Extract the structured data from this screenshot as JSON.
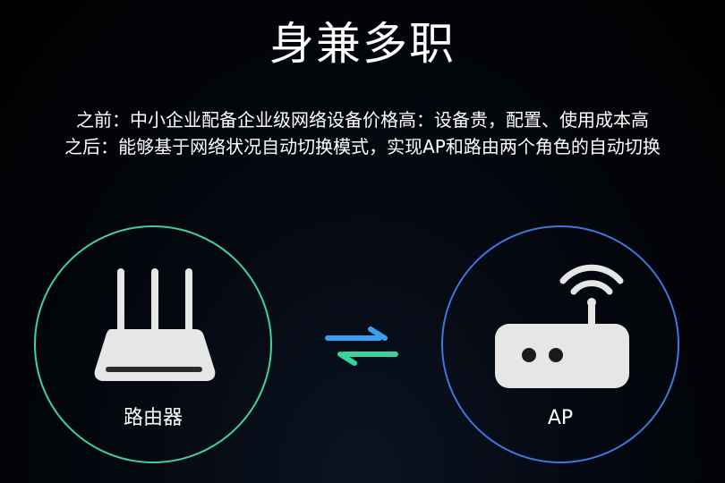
{
  "page": {
    "title": "身兼多职",
    "description": {
      "before": "之前：中小企业配备企业级网络设备价格高：设备贵，配置、使用成本高",
      "after": "之后：能够基于网络状况自动切换模式，实现AP和路由两个角色的自动切换"
    }
  },
  "modes": {
    "router": {
      "label": "路由器",
      "icon": "router-icon",
      "ring_color": "#3fd39a"
    },
    "ap": {
      "label": "AP",
      "icon": "access-point-icon",
      "ring_color": "#3f77e0"
    },
    "switch_icon": "swap-arrows-icon"
  },
  "colors": {
    "background": "#000000",
    "text": "#ffffff",
    "device_fill": "#e6e6e6",
    "arrow_top": "#3aa0ee",
    "arrow_bottom": "#38d39a"
  }
}
